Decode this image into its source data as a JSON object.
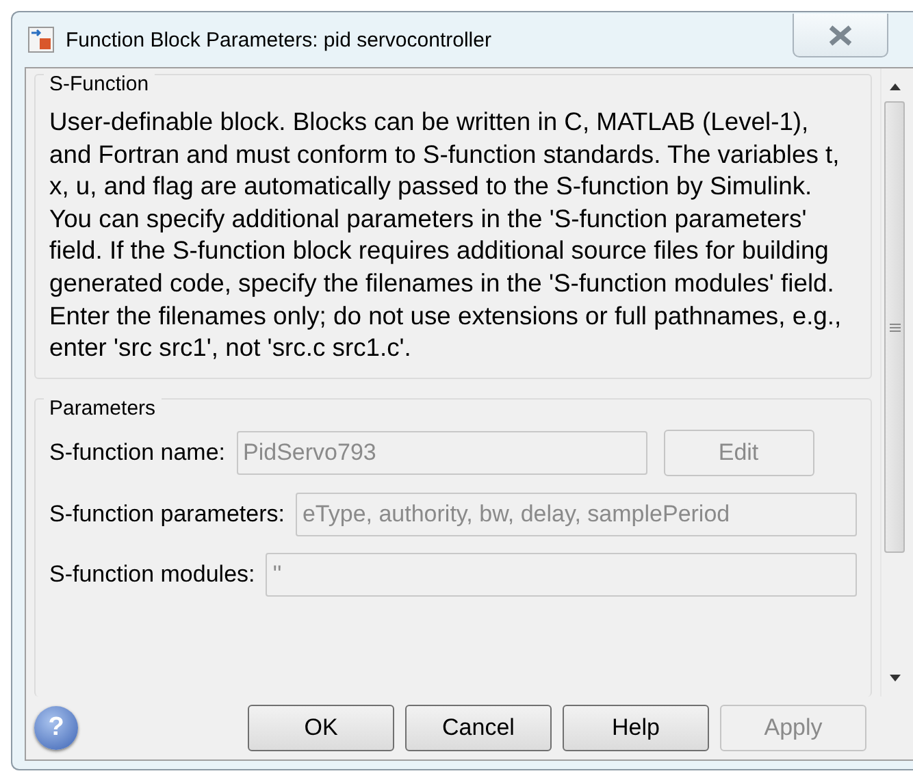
{
  "window": {
    "title": "Function Block Parameters: pid servocontroller"
  },
  "s_function": {
    "title": "S-Function",
    "description": "User-definable block.  Blocks can be written in C, MATLAB (Level-1), and Fortran and must conform to S-function standards. The variables t, x, u, and flag are automatically passed to the S-function by Simulink.  You can specify additional parameters in the 'S-function parameters' field. If the S-function block requires additional source files for building generated code, specify the filenames in the 'S-function modules' field. Enter the filenames only; do not use extensions or full pathnames, e.g., enter 'src src1', not 'src.c src1.c'."
  },
  "parameters": {
    "title": "Parameters",
    "fields": [
      {
        "label": "S-function name:",
        "value": "PidServo793",
        "disabled": true,
        "button": {
          "label": "Edit",
          "disabled": true
        }
      },
      {
        "label": "S-function parameters:",
        "value": "eType, authority, bw, delay, samplePeriod",
        "disabled": true
      },
      {
        "label": "S-function modules:",
        "value": "''",
        "disabled": true
      }
    ]
  },
  "help": {
    "glyph": "?"
  },
  "buttons": [
    {
      "label": "OK",
      "disabled": false
    },
    {
      "label": "Cancel",
      "disabled": false
    },
    {
      "label": "Help",
      "disabled": false
    },
    {
      "label": "Apply",
      "disabled": true
    }
  ]
}
